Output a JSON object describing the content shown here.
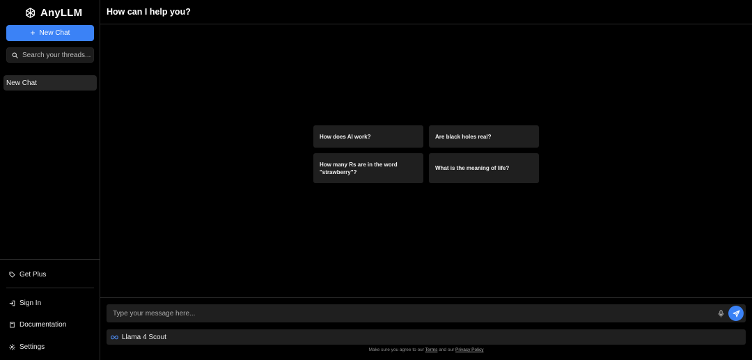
{
  "app": {
    "name": "AnyLLM"
  },
  "sidebar": {
    "new_chat_label": "New Chat",
    "search_placeholder": "Search your threads...",
    "threads": [
      {
        "label": "New Chat"
      }
    ],
    "bottom_links": [
      {
        "label": "Get Plus",
        "icon": "tag-icon"
      },
      {
        "label": "Sign In",
        "icon": "sign-in-icon"
      },
      {
        "label": "Documentation",
        "icon": "book-icon"
      },
      {
        "label": "Settings",
        "icon": "gear-icon"
      }
    ]
  },
  "header": {
    "title": "How can I help you?"
  },
  "suggestions": [
    "How does AI work?",
    "Are black holes real?",
    "How many Rs are in the word \"strawberry\"?",
    "What is the meaning of life?"
  ],
  "composer": {
    "placeholder": "Type your message here...",
    "model_name": "Llama 4 Scout"
  },
  "footer": {
    "prefix": "Make sure you agree to our",
    "terms_label": "Terms",
    "middle": "and our",
    "privacy_label": "Privacy Policy"
  },
  "colors": {
    "background": "#000000",
    "accent": "#3b82f6",
    "surface": "#1f1f1f",
    "border": "#2a2a2a"
  }
}
